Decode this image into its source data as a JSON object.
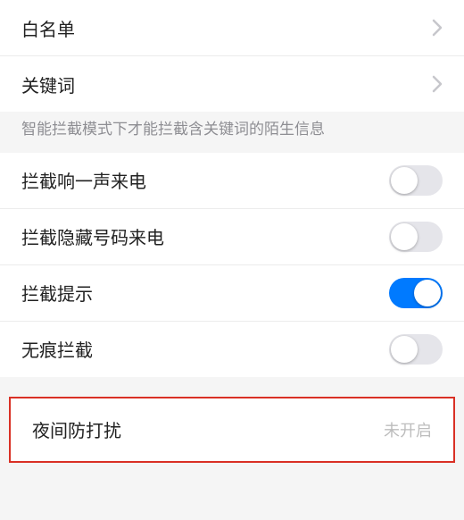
{
  "group1": {
    "whitelist": "白名单",
    "keywords": "关键词"
  },
  "hint": "智能拦截模式下才能拦截含关键词的陌生信息",
  "group2": {
    "ring_once": {
      "label": "拦截响一声来电",
      "on": false
    },
    "hidden_number": {
      "label": "拦截隐藏号码来电",
      "on": false
    },
    "block_notify": {
      "label": "拦截提示",
      "on": true
    },
    "traceless": {
      "label": "无痕拦截",
      "on": false
    }
  },
  "night_dnd": {
    "label": "夜间防打扰",
    "value": "未开启"
  }
}
